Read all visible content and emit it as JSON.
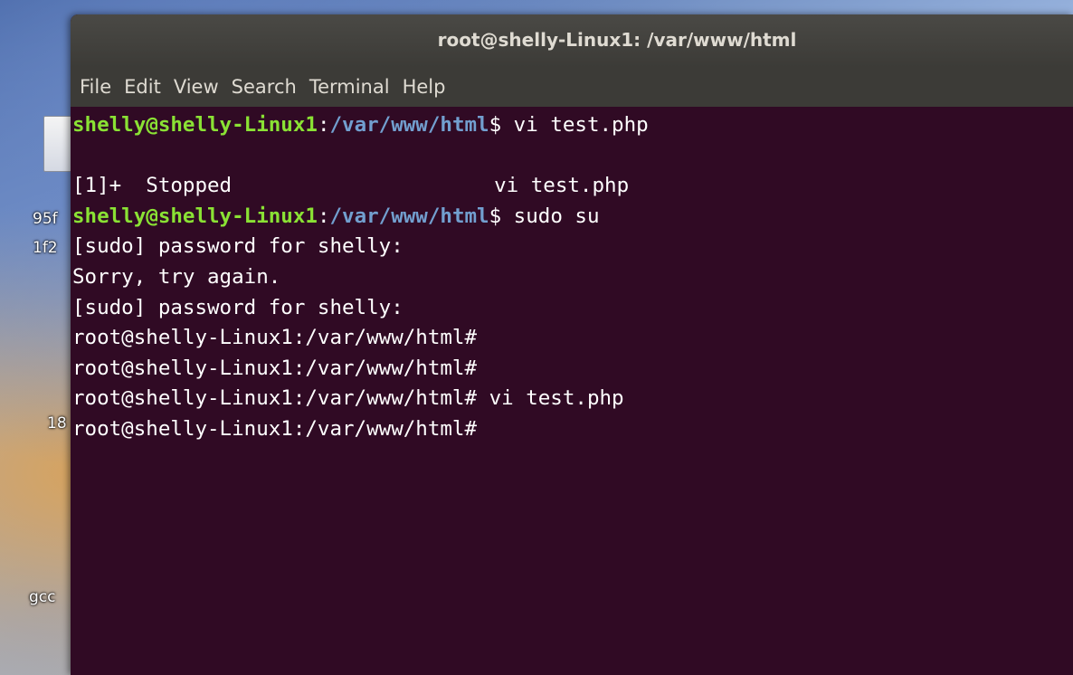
{
  "window": {
    "title": "root@shelly-Linux1: /var/www/html"
  },
  "menu": {
    "items": [
      "File",
      "Edit",
      "View",
      "Search",
      "Terminal",
      "Help"
    ]
  },
  "desktop": {
    "fragments": [
      "95f",
      "1f2",
      "18",
      "gcc"
    ]
  },
  "terminal": {
    "user_prompt": "shelly@shelly-Linux1",
    "path": "/var/www/html",
    "dollar": "$",
    "line1_cmd": " vi test.php",
    "line3_job": "[1]+  Stopped",
    "line3_cmd": "vi test.php",
    "line4_cmd": " sudo su",
    "line5": "[sudo] password for shelly:",
    "line6": "Sorry, try again.",
    "line7": "[sudo] password for shelly:",
    "line8": "root@shelly-Linux1:/var/www/html#",
    "line9": "root@shelly-Linux1:/var/www/html#",
    "line10": "root@shelly-Linux1:/var/www/html# vi test.php",
    "line11": "root@shelly-Linux1:/var/www/html#"
  },
  "colors": {
    "terminal_bg": "#300a24",
    "prompt_user": "#8ae234",
    "prompt_path": "#729fcf",
    "titlebar": "#3c3b37"
  }
}
